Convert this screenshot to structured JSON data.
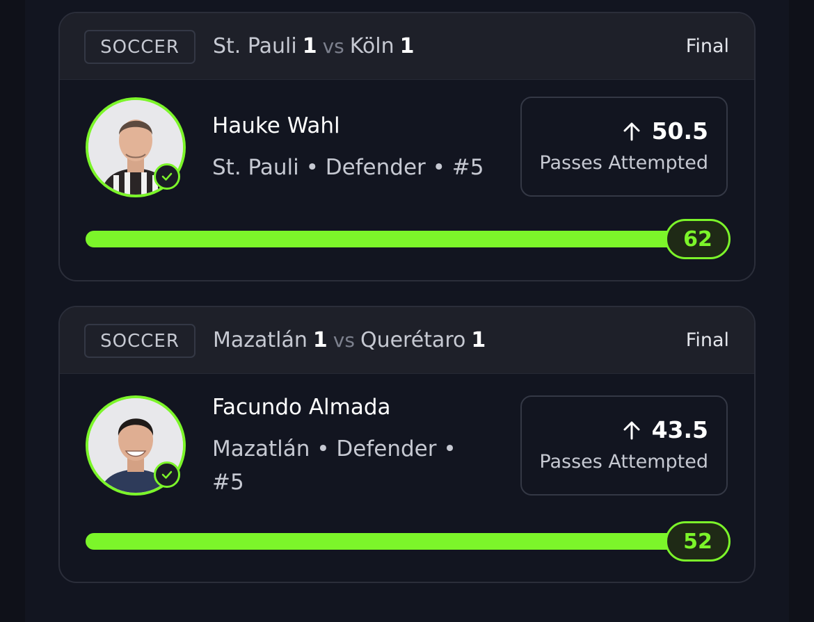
{
  "colors": {
    "accent": "#7cf52a",
    "background": "#121520",
    "header": "#1e2029"
  },
  "cards": [
    {
      "sport": "SOCCER",
      "home_team": "St. Pauli",
      "home_score": "1",
      "vs": "vs",
      "away_team": "Köln",
      "away_score": "1",
      "status": "Final",
      "player": {
        "name": "Hauke Wahl",
        "meta": "St. Pauli • Defender • #5",
        "avatar_icon": "player-photo",
        "verified_icon": "check-icon"
      },
      "line": {
        "direction_icon": "arrow-up-icon",
        "value": "50.5",
        "stat": "Passes Attempted"
      },
      "result": "62",
      "progress": 1.0
    },
    {
      "sport": "SOCCER",
      "home_team": "Mazatlán",
      "home_score": "1",
      "vs": "vs",
      "away_team": "Querétaro",
      "away_score": "1",
      "status": "Final",
      "player": {
        "name": "Facundo Almada",
        "meta": "Mazatlán • Defender • #5",
        "avatar_icon": "player-photo",
        "verified_icon": "check-icon"
      },
      "line": {
        "direction_icon": "arrow-up-icon",
        "value": "43.5",
        "stat": "Passes Attempted"
      },
      "result": "52",
      "progress": 1.0
    }
  ]
}
